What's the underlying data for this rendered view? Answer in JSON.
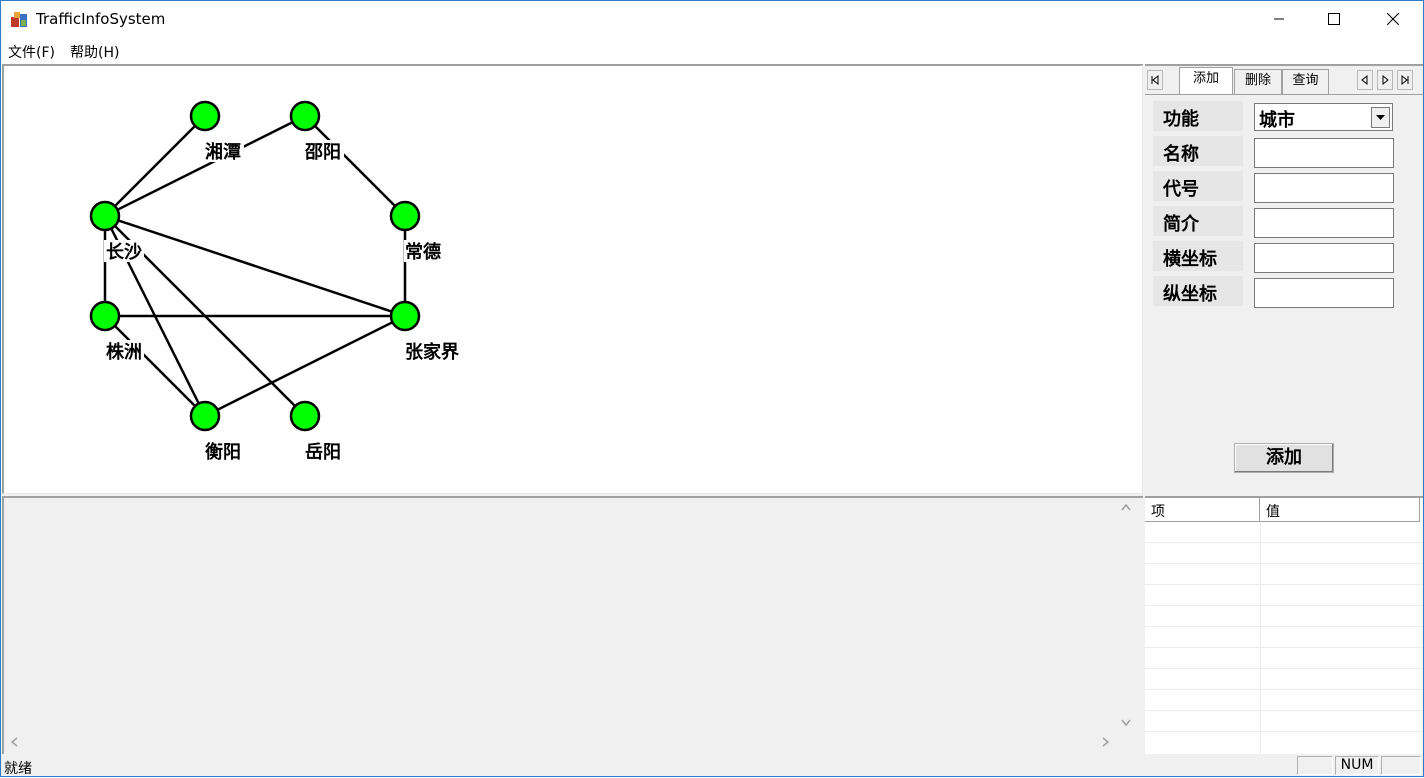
{
  "window": {
    "title": "TrafficInfoSystem"
  },
  "menu": [
    "文件(F)",
    "帮助(H)"
  ],
  "graph": {
    "node_color": "#00ff00",
    "cities": [
      "湘潭",
      "邵阳",
      "长沙",
      "常德",
      "株洲",
      "张家界",
      "衡阳",
      "岳阳"
    ]
  },
  "tabs": [
    "添加",
    "删除",
    "查询"
  ],
  "form": {
    "function_label": "功能",
    "function_value": "城市",
    "fields": [
      "名称",
      "代号",
      "简介",
      "横坐标",
      "纵坐标"
    ],
    "submit_label": "添加"
  },
  "property_list": {
    "columns": [
      "项",
      "值"
    ]
  },
  "status": {
    "text": "就绪",
    "num": "NUM"
  }
}
